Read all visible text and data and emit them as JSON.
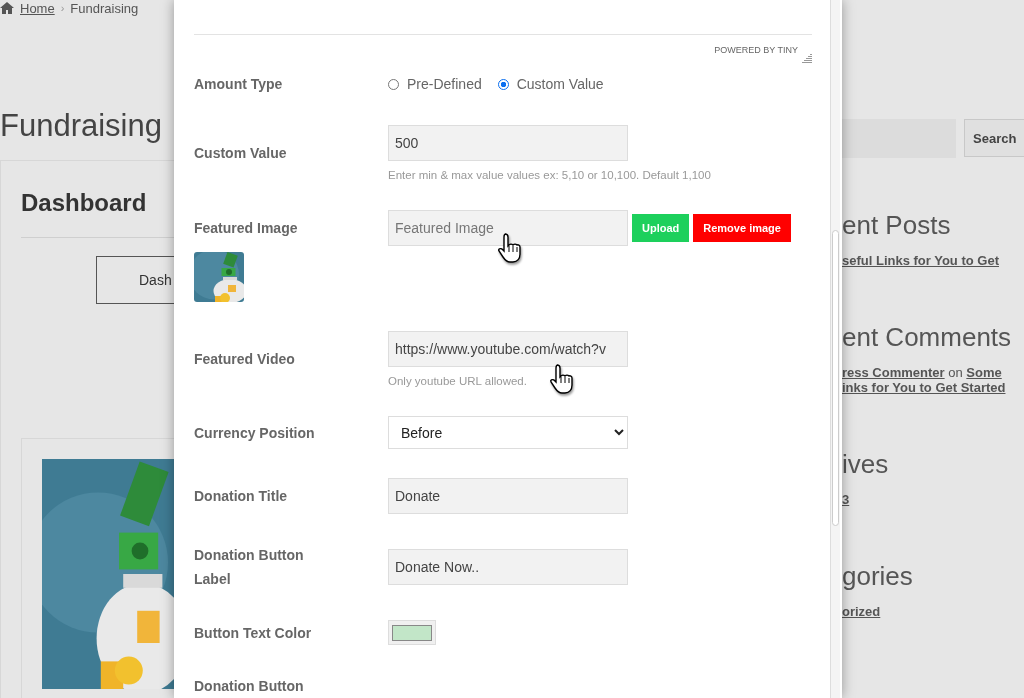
{
  "breadcrumb": [
    {
      "label": "Home",
      "kind": "link"
    },
    {
      "label": "›",
      "kind": "separator"
    },
    {
      "label": "Fundraising",
      "kind": "current"
    }
  ],
  "page_title": "Fundraising",
  "card": {
    "title": "Dashboard",
    "button": "Dash"
  },
  "sidebar": {
    "search_button": "Search",
    "sections": [
      {
        "heading": "ent Posts",
        "lines": [
          [
            {
              "text": "seful Links for You to Get",
              "link": true
            }
          ]
        ]
      },
      {
        "heading": "ent Comments",
        "lines": [
          [
            {
              "text": "ress Commenter",
              "link": true
            },
            {
              "text": "on",
              "link": false
            },
            {
              "text": "Some",
              "link": true
            }
          ],
          [
            {
              "text": "inks for You to Get Started",
              "link": true
            }
          ]
        ]
      },
      {
        "heading": "ives",
        "lines": [
          [
            {
              "text": "3",
              "link": true
            }
          ]
        ]
      },
      {
        "heading": "gories",
        "lines": [
          [
            {
              "text": "orized",
              "link": true
            }
          ]
        ]
      }
    ]
  },
  "modal": {
    "editor_footer": "POWERED BY TINY",
    "fields": [
      {
        "kind": "radio",
        "label": "Amount Type",
        "options": [
          {
            "label": "Pre-Defined",
            "selected": false
          },
          {
            "label": "Custom Value",
            "selected": true
          }
        ]
      },
      {
        "kind": "text",
        "label": "Custom Value",
        "value": "500",
        "help": "Enter min & max value values ex: 5,10 or 10,100. Default 1,100",
        "cursor": false
      },
      {
        "label": "Featured Image",
        "placeholder": "Featured Image",
        "upload": "Upload",
        "remove": "Remove image",
        "cursor": true
      },
      {
        "kind": "text",
        "label": "Featured Video",
        "value": "https://www.youtube.com/watch?v",
        "help": "Only youtube URL allowed.",
        "cursor": true
      },
      {
        "kind": "select",
        "label": "Currency Position",
        "value": "Before"
      },
      {
        "kind": "text",
        "label": "Donation Title",
        "value": "Donate",
        "cursor": false
      },
      {
        "kind": "text",
        "label": "Donation Button Label",
        "value": "Donate Now..",
        "cursor": false
      },
      {
        "kind": "color",
        "label": "Button Text Color",
        "color": "#c2e6c8"
      },
      {
        "kind": "label",
        "label": "Donation Button"
      }
    ]
  }
}
